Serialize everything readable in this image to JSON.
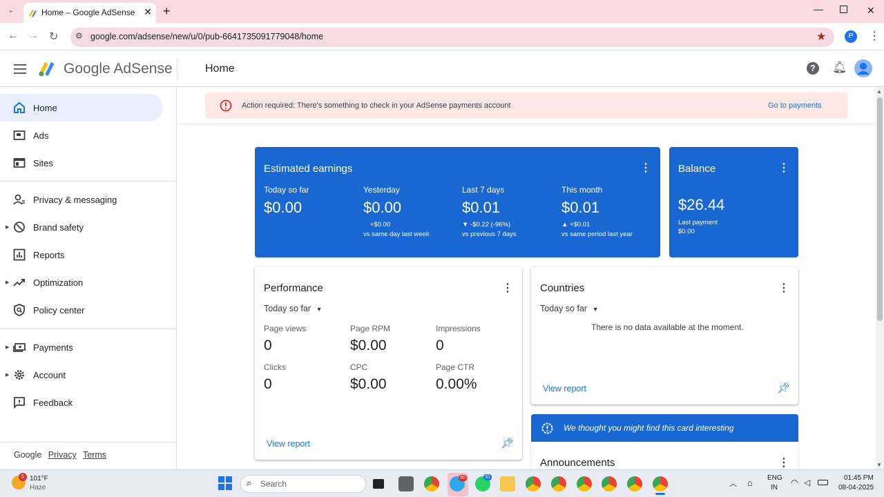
{
  "browser": {
    "tab_title": "Home – Google AdSense",
    "url": "google.com/adsense/new/u/0/pub-6641735091779048/home",
    "profile_initial": "P"
  },
  "header": {
    "brand": "Google AdSense",
    "page_title": "Home"
  },
  "sidebar": {
    "items": [
      {
        "label": "Home",
        "icon": "home-icon"
      },
      {
        "label": "Ads",
        "icon": "ads-icon"
      },
      {
        "label": "Sites",
        "icon": "sites-icon"
      },
      {
        "label": "Privacy & messaging",
        "icon": "privacy-icon"
      },
      {
        "label": "Brand safety",
        "icon": "block-icon"
      },
      {
        "label": "Reports",
        "icon": "bar-chart-icon"
      },
      {
        "label": "Optimization",
        "icon": "trending-up-icon"
      },
      {
        "label": "Policy center",
        "icon": "policy-icon"
      },
      {
        "label": "Payments",
        "icon": "payments-icon"
      },
      {
        "label": "Account",
        "icon": "gear-icon"
      },
      {
        "label": "Feedback",
        "icon": "feedback-icon"
      }
    ],
    "footer": {
      "google": "Google",
      "privacy": "Privacy",
      "terms": "Terms"
    }
  },
  "alert": {
    "text": "Action required: There's something to check in your AdSense payments account",
    "link": "Go to payments"
  },
  "earnings": {
    "title": "Estimated earnings",
    "cols": [
      {
        "label": "Today so far",
        "value": "$0.00",
        "delta": "",
        "note": ""
      },
      {
        "label": "Yesterday",
        "value": "$0.00",
        "delta": "+$0.00",
        "note": "vs same day last week"
      },
      {
        "label": "Last 7 days",
        "value": "$0.01",
        "delta": "▼ -$0.22 (-96%)",
        "note": "vs previous 7 days"
      },
      {
        "label": "This month",
        "value": "$0.01",
        "delta": "▲ +$0.01",
        "note": "vs same period last year"
      }
    ]
  },
  "balance": {
    "title": "Balance",
    "value": "$26.44",
    "last_payment_label": "Last payment",
    "last_payment_value": "$0.00"
  },
  "performance": {
    "title": "Performance",
    "range": "Today so far",
    "metrics": [
      {
        "label": "Page views",
        "value": "0"
      },
      {
        "label": "Page RPM",
        "value": "$0.00"
      },
      {
        "label": "Impressions",
        "value": "0"
      },
      {
        "label": "Clicks",
        "value": "0"
      },
      {
        "label": "CPC",
        "value": "$0.00"
      },
      {
        "label": "Page CTR",
        "value": "0.00%"
      }
    ],
    "link": "View report"
  },
  "countries": {
    "title": "Countries",
    "range": "Today so far",
    "empty": "There is no data available at the moment.",
    "link": "View report"
  },
  "interesting": {
    "text": "We thought you might find this card interesting"
  },
  "announcements": {
    "title": "Announcements"
  },
  "taskbar": {
    "weather_temp": "101°F",
    "weather_desc": "Haze",
    "weather_badge": "5",
    "search": "Search",
    "lang": "ENG",
    "region": "IN",
    "time": "01:45 PM",
    "date": "08-04-2025",
    "telegram_badge": "80",
    "whatsapp_badge": "31"
  },
  "colors": {
    "accent": "#1a73e8",
    "card_blue": "#1967d2",
    "alert_bg": "#fce8e6",
    "alert_icon": "#d93025",
    "tabbar_bg": "#f9d9e2"
  }
}
